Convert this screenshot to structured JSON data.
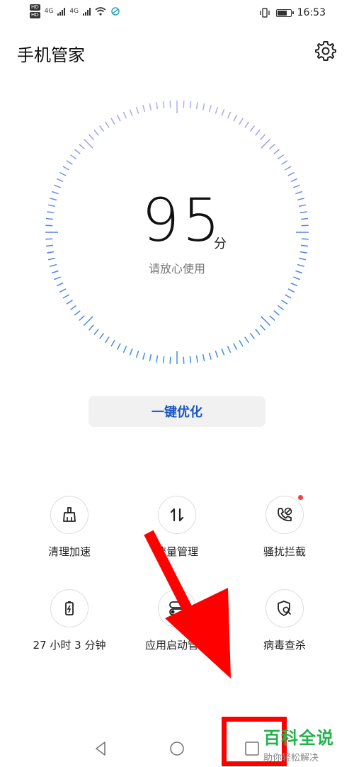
{
  "status_bar": {
    "hd1": "HD",
    "hd2": "HD",
    "net1": "4G",
    "net2": "4G",
    "time": "16:53",
    "battery_level": 0.8
  },
  "app": {
    "title": "手机管家"
  },
  "score": {
    "value": "95",
    "unit": "分",
    "subtitle": "请放心使用",
    "accent_color": "#6a6ee6",
    "accent_color_2": "#3f8fe6"
  },
  "optimize_button": {
    "label": "一键优化"
  },
  "features": [
    {
      "label": "清理加速",
      "icon": "broom-icon"
    },
    {
      "label": "流量管理",
      "icon": "data-arrows-icon"
    },
    {
      "label": "骚扰拦截",
      "icon": "blocked-call-icon",
      "badge": true
    },
    {
      "label": "27 小时 3 分钟",
      "icon": "battery-icon"
    },
    {
      "label": "应用启动管理",
      "icon": "app-launch-icon"
    },
    {
      "label": "病毒查杀",
      "icon": "virus-scan-icon"
    }
  ],
  "watermark": {
    "title": "百科全说",
    "subtitle": "助你轻松解决"
  }
}
